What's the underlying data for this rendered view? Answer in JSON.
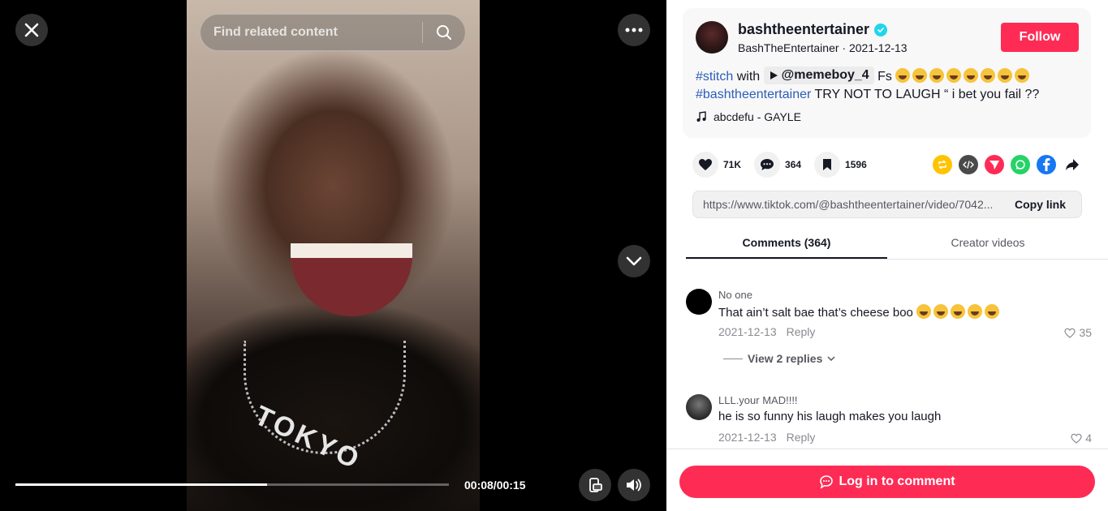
{
  "video": {
    "search_placeholder": "Find related content",
    "shirt_text": "TOKYO",
    "time_display": "00:08/00:15",
    "progress_fraction": 0.58
  },
  "icons": {
    "close": "close-icon",
    "more": "more-icon",
    "search": "search-icon",
    "down": "chevron-down-icon",
    "rotate": "device-rotate-icon",
    "volume": "volume-icon"
  },
  "author": {
    "username": "bashtheentertainer",
    "display_name": "BashTheEntertainer",
    "date": "2021-12-13",
    "separator": " · ",
    "verified": true,
    "follow_label": "Follow"
  },
  "caption": {
    "hashtag1": "#stitch",
    "with_word": "with",
    "stitch_user": "@memeboy_4",
    "text1": "Fs",
    "emoji_count": 8,
    "hashtag2": "#bashtheentertainer",
    "text2": "TRY NOT TO LAUGH “ i bet you fail ??"
  },
  "music": {
    "title": "abcdefu - GAYLE"
  },
  "stats": {
    "likes": "71K",
    "comments": "364",
    "saves": "1596"
  },
  "share": {
    "link_url": "https://www.tiktok.com/@bashtheentertainer/video/7042...",
    "copy_label": "Copy link"
  },
  "tabs": {
    "comments": "Comments (364)",
    "creator": "Creator videos"
  },
  "comments": [
    {
      "user": "No one",
      "text": "That ain’t salt bae that’s cheese boo",
      "emoji_count": 5,
      "date": "2021-12-13",
      "reply_label": "Reply",
      "likes": "35",
      "view_replies": "View 2 replies"
    },
    {
      "user": "LLL.your MAD!!!!",
      "text": "he is so funny his laugh makes you laugh",
      "emoji_count": 0,
      "date": "2021-12-13",
      "reply_label": "Reply",
      "likes": "4"
    }
  ],
  "footer": {
    "login_label": "Log in to comment"
  },
  "colors": {
    "accent": "#fe2c55",
    "hashtag": "#2b5db9",
    "verified": "#20d5ec"
  }
}
